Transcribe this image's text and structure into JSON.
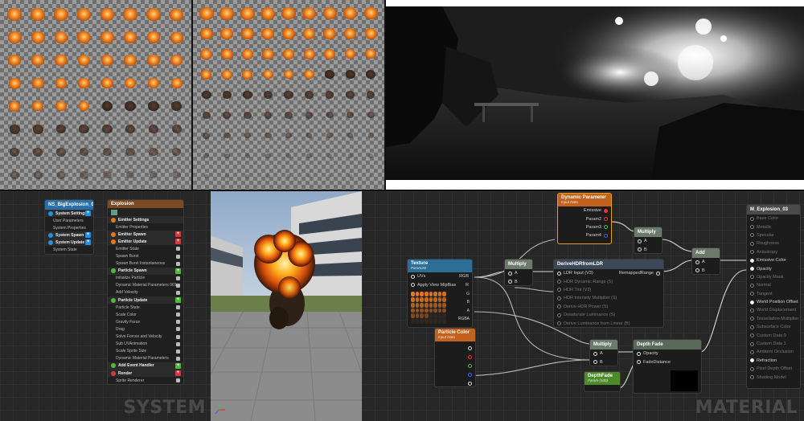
{
  "colors": {
    "fire_orange": "#e87a1a",
    "smoke_dark": "#2a2420",
    "node_param": "#c2621c",
    "node_texture": "#2c6e98",
    "node_math": "#6c7a6c",
    "node_depthfade_param": "#4c8a2a",
    "stack_spawn_blue": "#2a8fd6",
    "stack_update_orange": "#e27a1c",
    "stack_green": "#4fb83a",
    "stack_red": "#d33a3a"
  },
  "panel_labels": {
    "system": "SYSTEM",
    "material": "MATERIAL"
  },
  "system_overview": {
    "title": "NS_BigExplosion_03",
    "rows": [
      {
        "label": "System Settings",
        "kind": "group",
        "color": "#2a8fd6"
      },
      {
        "label": "User Parameters",
        "kind": "item"
      },
      {
        "label": "System Properties",
        "kind": "item"
      },
      {
        "label": "System Spawn",
        "kind": "group",
        "color": "#2a8fd6"
      },
      {
        "label": "System Update",
        "kind": "group",
        "color": "#2a8fd6"
      },
      {
        "label": "System State",
        "kind": "item"
      }
    ]
  },
  "emitter": {
    "title": "Explosion",
    "rows": [
      {
        "label": "Emitter Settings",
        "kind": "group",
        "color": "#e27a1c"
      },
      {
        "label": "Emitter Properties",
        "kind": "item"
      },
      {
        "label": "Emitter Spawn",
        "kind": "group",
        "color": "#e27a1c",
        "plus": "#d33a3a"
      },
      {
        "label": "Emitter Update",
        "kind": "group",
        "color": "#e27a1c",
        "plus": "#d33a3a"
      },
      {
        "label": "Emitter State",
        "kind": "item",
        "check": true
      },
      {
        "label": "Spawn Burst",
        "kind": "item",
        "check": true
      },
      {
        "label": "Spawn Burst Instantaneous",
        "kind": "item",
        "check": true
      },
      {
        "label": "Particle Spawn",
        "kind": "group",
        "color": "#4fb83a",
        "plus": "#4fb83a"
      },
      {
        "label": "Initialize Particle",
        "kind": "item",
        "check": true
      },
      {
        "label": "Dynamic Material Parameters 001",
        "kind": "item",
        "check": true
      },
      {
        "label": "Add Velocity",
        "kind": "item",
        "check": true
      },
      {
        "label": "Particle Update",
        "kind": "group",
        "color": "#4fb83a",
        "plus": "#4fb83a"
      },
      {
        "label": "Particle State",
        "kind": "item",
        "check": true
      },
      {
        "label": "Scale Color",
        "kind": "item",
        "check": true
      },
      {
        "label": "Gravity Force",
        "kind": "item",
        "check": true
      },
      {
        "label": "Drag",
        "kind": "item",
        "check": true
      },
      {
        "label": "Solve Forces and Velocity",
        "kind": "item",
        "check": true
      },
      {
        "label": "Sub UVAnimation",
        "kind": "item",
        "check": true
      },
      {
        "label": "Scale Sprite Size",
        "kind": "item",
        "check": true
      },
      {
        "label": "Dynamic Material Parameters",
        "kind": "item",
        "check": true
      },
      {
        "label": "Add Event Handler",
        "kind": "group",
        "color": "#4fb83a",
        "plus": "#4fb83a"
      },
      {
        "label": "Render",
        "kind": "group",
        "color": "#d33a3a",
        "plus": "#d33a3a"
      },
      {
        "label": "Sprite Renderer",
        "kind": "item",
        "check": true
      }
    ]
  },
  "material": {
    "dynamic_parameter": {
      "title": "Dynamic Parameter",
      "subtitle": "Input Data",
      "outputs": [
        "Emissive",
        "Param2",
        "Param3",
        "Param4"
      ]
    },
    "texture": {
      "title": "Texture",
      "subtitle": "Param2D",
      "inputs": [
        "UVs",
        "Apply View MipBias"
      ],
      "outputs": [
        "RGB",
        "R",
        "G",
        "B",
        "A",
        "RGBA"
      ]
    },
    "multiply_1": {
      "title": "Multiply",
      "inputs": [
        "A",
        "B"
      ]
    },
    "multiply_2": {
      "title": "Multiply",
      "inputs": [
        "A",
        "B"
      ]
    },
    "multiply_3": {
      "title": "Multiply",
      "inputs": [
        "A",
        "B"
      ]
    },
    "add": {
      "title": "Add",
      "inputs": [
        "A",
        "B"
      ]
    },
    "derive_hdr": {
      "title": "DeriveHDRfromLDR",
      "inputs": [
        "LDR Input (V3)",
        "HDR Dynamic Range (S)",
        "HDR Tint (V3)",
        "HDR Intensity Multiplier (S)",
        "Derive HDR Power (S)",
        "Desaturate Luminance (S)",
        "Derive Luminance from Linear (B)"
      ],
      "output": "RemappedRange"
    },
    "particle_color": {
      "title": "Particle Color",
      "subtitle": "Input Data"
    },
    "depth_fade": {
      "title": "Depth Fade",
      "inputs": [
        "Opacity",
        "FadeDistance"
      ]
    },
    "depth_fade_param": {
      "title": "DepthFade",
      "subtitle": "Param (100)"
    },
    "result": {
      "title": "M_Explosion_03",
      "pins": [
        {
          "label": "Base Color",
          "active": false
        },
        {
          "label": "Metallic",
          "active": false
        },
        {
          "label": "Specular",
          "active": false
        },
        {
          "label": "Roughness",
          "active": false
        },
        {
          "label": "Anisotropy",
          "active": false
        },
        {
          "label": "Emissive Color",
          "active": true
        },
        {
          "label": "Opacity",
          "active": true
        },
        {
          "label": "Opacity Mask",
          "active": false
        },
        {
          "label": "Normal",
          "active": false
        },
        {
          "label": "Tangent",
          "active": false
        },
        {
          "label": "World Position Offset",
          "active": true
        },
        {
          "label": "World Displacement",
          "active": false
        },
        {
          "label": "Tessellation Multiplier",
          "active": false
        },
        {
          "label": "Subsurface Color",
          "active": false
        },
        {
          "label": "Custom Data 0",
          "active": false
        },
        {
          "label": "Custom Data 1",
          "active": false
        },
        {
          "label": "Ambient Occlusion",
          "active": false
        },
        {
          "label": "Refraction",
          "active": true
        },
        {
          "label": "Pixel Depth Offset",
          "active": false
        },
        {
          "label": "Shading Model",
          "active": false
        }
      ]
    }
  }
}
